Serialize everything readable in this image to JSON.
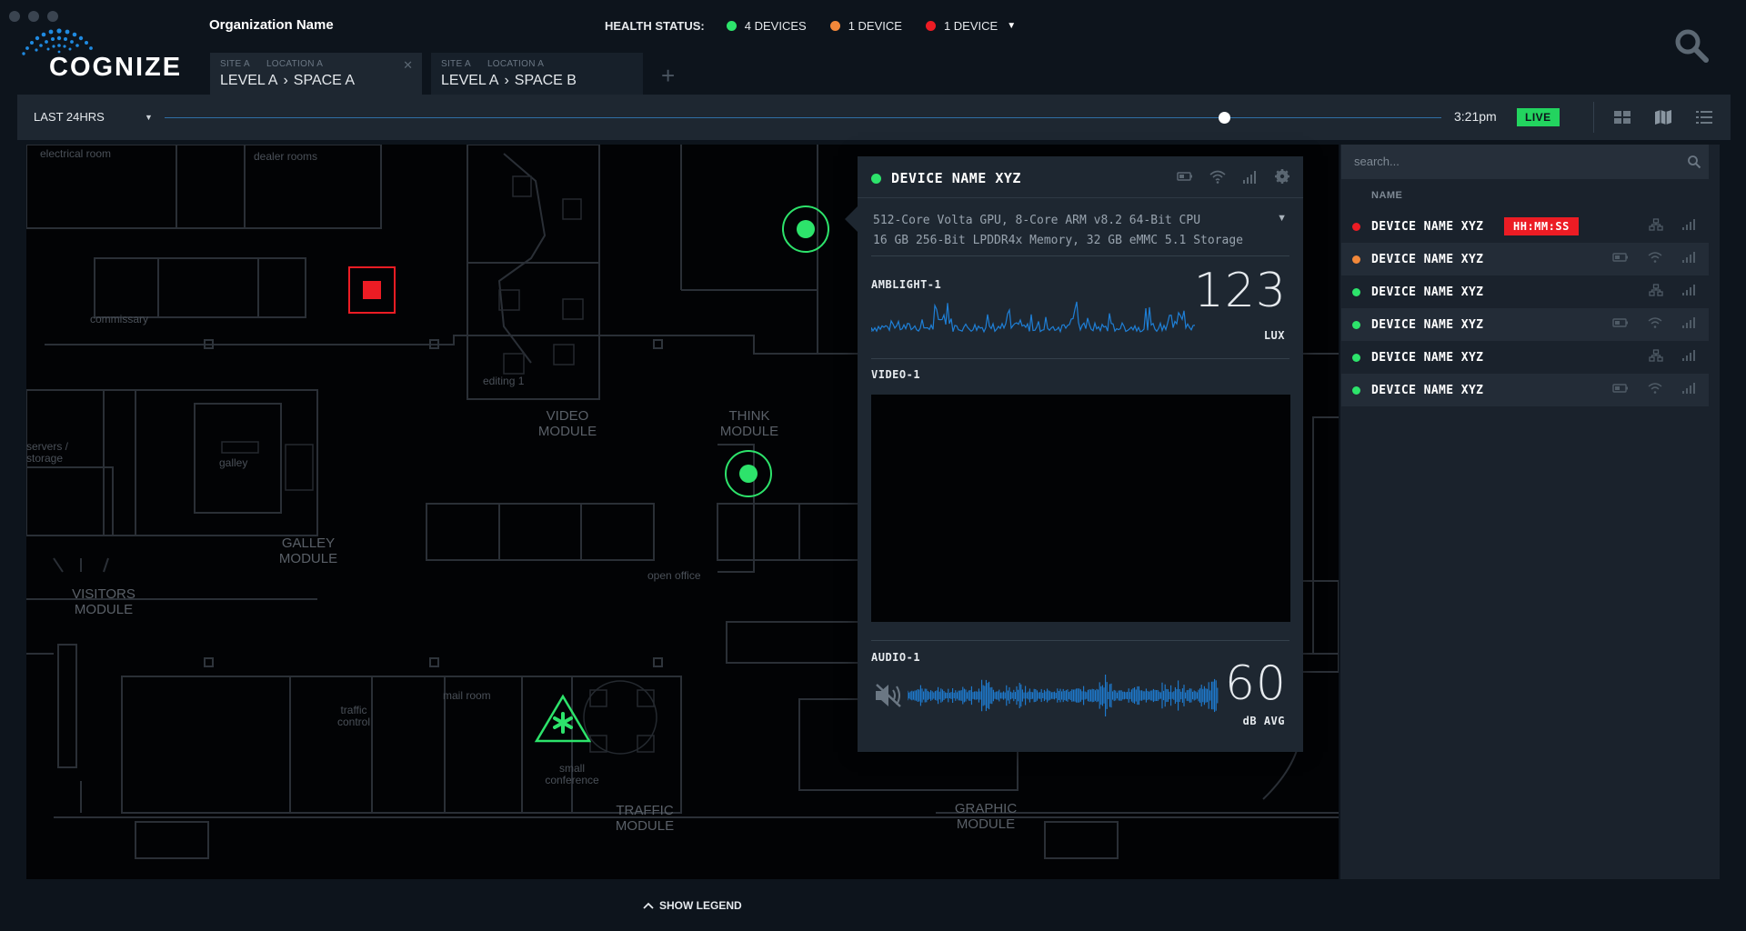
{
  "brand": {
    "name": "COGNIZE",
    "organization": "Organization Name"
  },
  "health": {
    "label": "HEALTH STATUS:",
    "items": [
      {
        "text": "4 DEVICES",
        "color": "#2de36b"
      },
      {
        "text": "1 DEVICE",
        "color": "#f2883a"
      },
      {
        "text": "1 DEVICE",
        "color": "#ec1c24"
      }
    ]
  },
  "tabs": [
    {
      "site": "SITE A",
      "location": "LOCATION A",
      "level": "LEVEL A",
      "space": "SPACE A",
      "active": true
    },
    {
      "site": "SITE A",
      "location": "LOCATION A",
      "level": "LEVEL A",
      "space": "SPACE B",
      "active": false
    }
  ],
  "timebar": {
    "range": "LAST 24HRS",
    "time": "3:21pm",
    "live": "LIVE",
    "position": 0.83
  },
  "map": {
    "labels": [
      "electrical room",
      "dealer rooms",
      "commissary",
      "editing 1",
      "VIDEO MODULE",
      "THINK MODULE",
      "servers / storage",
      "galley",
      "GALLEY MODULE",
      "VISITORS MODULE",
      "open office",
      "traffic control",
      "mail room",
      "small conference",
      "TRAFFIC MODULE",
      "GRAPHIC MODULE"
    ]
  },
  "popup": {
    "device_name": "DEVICE NAME XYZ",
    "spec_line1": "512-Core Volta GPU, 8-Core ARM v8.2 64-Bit CPU",
    "spec_line2": "16 GB 256-Bit LPDDR4x Memory, 32 GB eMMC 5.1 Storage",
    "amblight": {
      "label": "AMBLIGHT-1",
      "value": "123",
      "unit": "LUX"
    },
    "video": {
      "label": "VIDEO-1"
    },
    "audio": {
      "label": "AUDIO-1",
      "value": "60",
      "unit": "dB AVG"
    }
  },
  "sidebar": {
    "search_placeholder": "search...",
    "column": "NAME",
    "devices": [
      {
        "name": "DEVICE NAME XYZ",
        "status": "#ec1c24",
        "badge": "HH:MM:SS",
        "icons": [
          "network-icon",
          "signal-icon"
        ]
      },
      {
        "name": "DEVICE NAME XYZ",
        "status": "#f2883a",
        "badge": "",
        "icons": [
          "battery-icon",
          "wifi-icon",
          "signal-icon"
        ]
      },
      {
        "name": "DEVICE NAME XYZ",
        "status": "#2de36b",
        "badge": "",
        "icons": [
          "network-icon",
          "signal-icon"
        ]
      },
      {
        "name": "DEVICE NAME XYZ",
        "status": "#2de36b",
        "badge": "",
        "icons": [
          "battery-icon",
          "wifi-icon",
          "signal-icon"
        ]
      },
      {
        "name": "DEVICE NAME XYZ",
        "status": "#2de36b",
        "badge": "",
        "icons": [
          "network-icon",
          "signal-icon"
        ]
      },
      {
        "name": "DEVICE NAME XYZ",
        "status": "#2de36b",
        "badge": "",
        "icons": [
          "battery-icon",
          "wifi-icon",
          "signal-icon"
        ]
      }
    ]
  },
  "footer": {
    "legend": "SHOW LEGEND"
  }
}
